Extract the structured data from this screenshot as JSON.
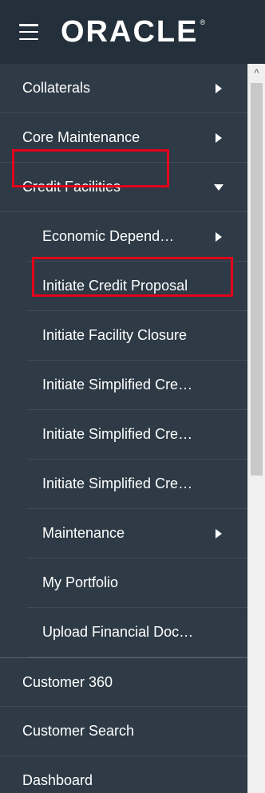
{
  "header": {
    "brand": "ORACLE",
    "brand_mark": "®",
    "menu_icon": "hamburger-menu-icon"
  },
  "menu": {
    "collaterals": "Collaterals",
    "core_maintenance": "Core Maintenance",
    "credit_facilities": "Credit Facilities",
    "credit_sub": {
      "economic_dependency": "Economic Depend…",
      "initiate_credit_proposal": "Initiate Credit Proposal",
      "initiate_facility_closure": "Initiate Facility Closure",
      "initiate_simplified_1": "Initiate Simplified Cre…",
      "initiate_simplified_2": "Initiate Simplified Cre…",
      "initiate_simplified_3": "Initiate Simplified Cre…",
      "maintenance": "Maintenance",
      "my_portfolio": "My Portfolio",
      "upload_financial": "Upload Financial Doc…"
    },
    "customer_360": "Customer 360",
    "customer_search": "Customer Search",
    "dashboard": "Dashboard"
  },
  "scrollbar": {
    "up_arrow_icon": "^"
  },
  "colors": {
    "header_bg": "#232f3a",
    "menu_bg": "#2e3b46",
    "highlight": "#e3001b"
  }
}
